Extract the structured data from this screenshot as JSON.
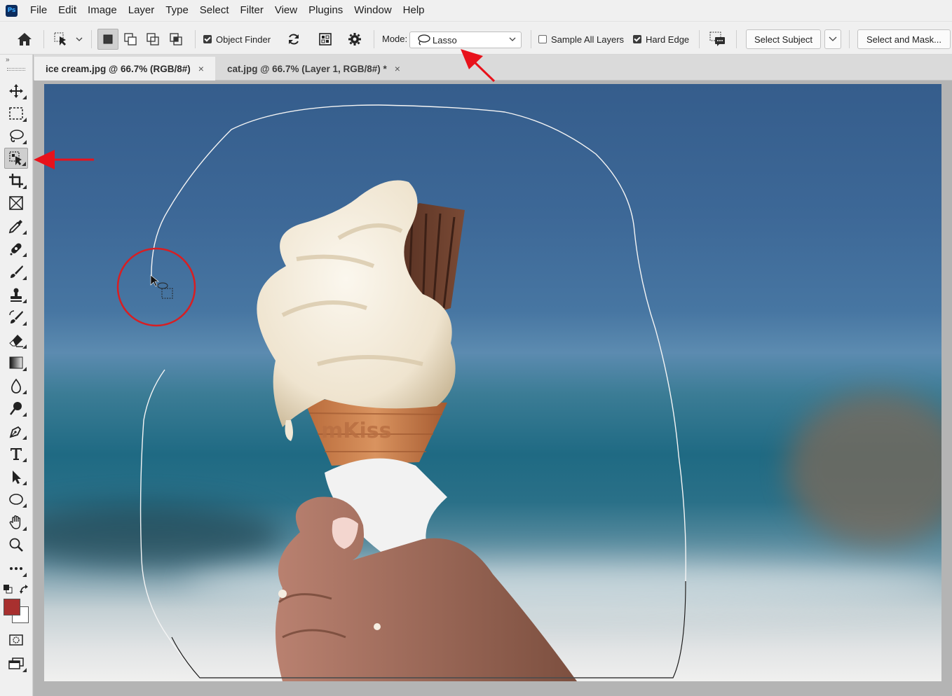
{
  "app": {
    "logo": "Ps"
  },
  "menu": [
    "File",
    "Edit",
    "Image",
    "Layer",
    "Type",
    "Select",
    "Filter",
    "View",
    "Plugins",
    "Window",
    "Help"
  ],
  "options": {
    "object_finder_label": "Object Finder",
    "object_finder_checked": true,
    "mode_label": "Mode:",
    "mode_value": "Lasso",
    "sample_all_layers_label": "Sample All Layers",
    "sample_all_layers_checked": false,
    "hard_edge_label": "Hard Edge",
    "hard_edge_checked": true,
    "select_subject_label": "Select Subject",
    "select_and_mask_label": "Select and Mask..."
  },
  "tabs": [
    {
      "label": "ice cream.jpg @ 66.7% (RGB/8#)",
      "close": "×",
      "active": true
    },
    {
      "label": "cat.jpg @ 66.7% (Layer 1, RGB/8#) *",
      "close": "×",
      "active": false
    }
  ],
  "toolbar": {
    "collapse": "»",
    "tools": [
      "move-tool",
      "rectangular-marquee-tool",
      "lasso-tool",
      "object-selection-tool",
      "crop-tool",
      "frame-tool",
      "eyedropper-tool",
      "spot-healing-tool",
      "brush-tool",
      "clone-stamp-tool",
      "history-brush-tool",
      "eraser-tool",
      "gradient-tool",
      "blur-tool",
      "dodge-tool",
      "pen-tool",
      "type-tool",
      "path-selection-tool",
      "ellipse-tool",
      "hand-tool",
      "zoom-tool",
      "more-tools"
    ],
    "active_tool": "object-selection-tool",
    "foreground_color": "#a8302f",
    "background_color": "#ffffff"
  },
  "canvas": {
    "cone_text": "mKiss"
  },
  "annotations": {
    "arrow_color": "#e8121b",
    "circle_color": "#d81e22"
  }
}
